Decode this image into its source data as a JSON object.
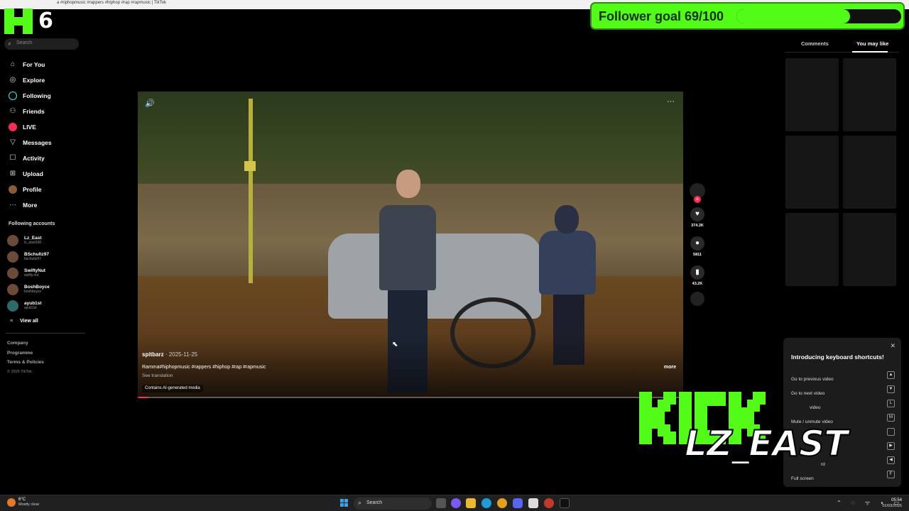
{
  "browser": {
    "tab_title": "a #riphopmusic #rappers #hiphop #rap #rapmusic | TikTok"
  },
  "kick_overlay": {
    "number": "6"
  },
  "follower_goal": {
    "label": "Follower goal 69/100",
    "current": 69,
    "target": 100
  },
  "sidebar": {
    "search_placeholder": "Search",
    "nav": [
      {
        "label": "For You",
        "icon": "home-icon"
      },
      {
        "label": "Explore",
        "icon": "compass-icon"
      },
      {
        "label": "Following",
        "icon": "following-icon"
      },
      {
        "label": "Friends",
        "icon": "friends-icon"
      },
      {
        "label": "LIVE",
        "icon": "live-icon"
      },
      {
        "label": "Messages",
        "icon": "messages-icon"
      },
      {
        "label": "Activity",
        "icon": "activity-icon"
      },
      {
        "label": "Upload",
        "icon": "upload-icon"
      },
      {
        "label": "Profile",
        "icon": "profile-icon"
      },
      {
        "label": "More",
        "icon": "more-icon"
      }
    ],
    "following_header": "Following accounts",
    "accounts": [
      {
        "name": "Lz_East",
        "handle": "lz_east100"
      },
      {
        "name": "BSchultz97",
        "handle": "bschultz97"
      },
      {
        "name": "SwiftyNut",
        "handle": "swifty.nut"
      },
      {
        "name": "BoshBoyce",
        "handle": "boshboyce"
      },
      {
        "name": "ayub1st",
        "handle": "ayub1st"
      }
    ],
    "view_all": "View all",
    "footer": [
      "Company",
      "Programme",
      "Terms & Policies"
    ],
    "copyright": "© 2026 TikTok"
  },
  "video": {
    "author": "spitbarz",
    "date": "· 2025-11-25",
    "caption": "Ramma#hiphopmusic #rappers #hiphop #rap #rapmusic",
    "see_translation": "See translation",
    "more": "more",
    "ai_label": "Contains AI-generated media",
    "progress": 0.02
  },
  "actions": {
    "likes": "374.2K",
    "comments": "5811",
    "saves": "43.2K"
  },
  "right_panel": {
    "tabs": [
      "Comments",
      "You may like"
    ],
    "active_tab": "You may like"
  },
  "shortcuts": {
    "title": "Introducing keyboard shortcuts!",
    "rows": [
      {
        "label": "Go to previous video",
        "key": "▲"
      },
      {
        "label": "Go to next video",
        "key": "▼"
      },
      {
        "label": "video",
        "key": "L"
      },
      {
        "label": "Mute / unmute video",
        "key": "M"
      },
      {
        "label": "",
        "key": ""
      },
      {
        "label": "",
        "key": "▶"
      },
      {
        "label": "rd",
        "key": "◀"
      },
      {
        "label": "Full screen",
        "key": "F"
      }
    ]
  },
  "kick_watermark": {
    "streamer": "LZ_EAST"
  },
  "taskbar": {
    "weather_temp": "6°C",
    "weather_desc": "Mostly clear",
    "search": "Search",
    "time": "05:54",
    "date": "01/03/2026"
  },
  "colors": {
    "kick_green": "#53fc18",
    "tiktok_red": "#fe2c55"
  }
}
